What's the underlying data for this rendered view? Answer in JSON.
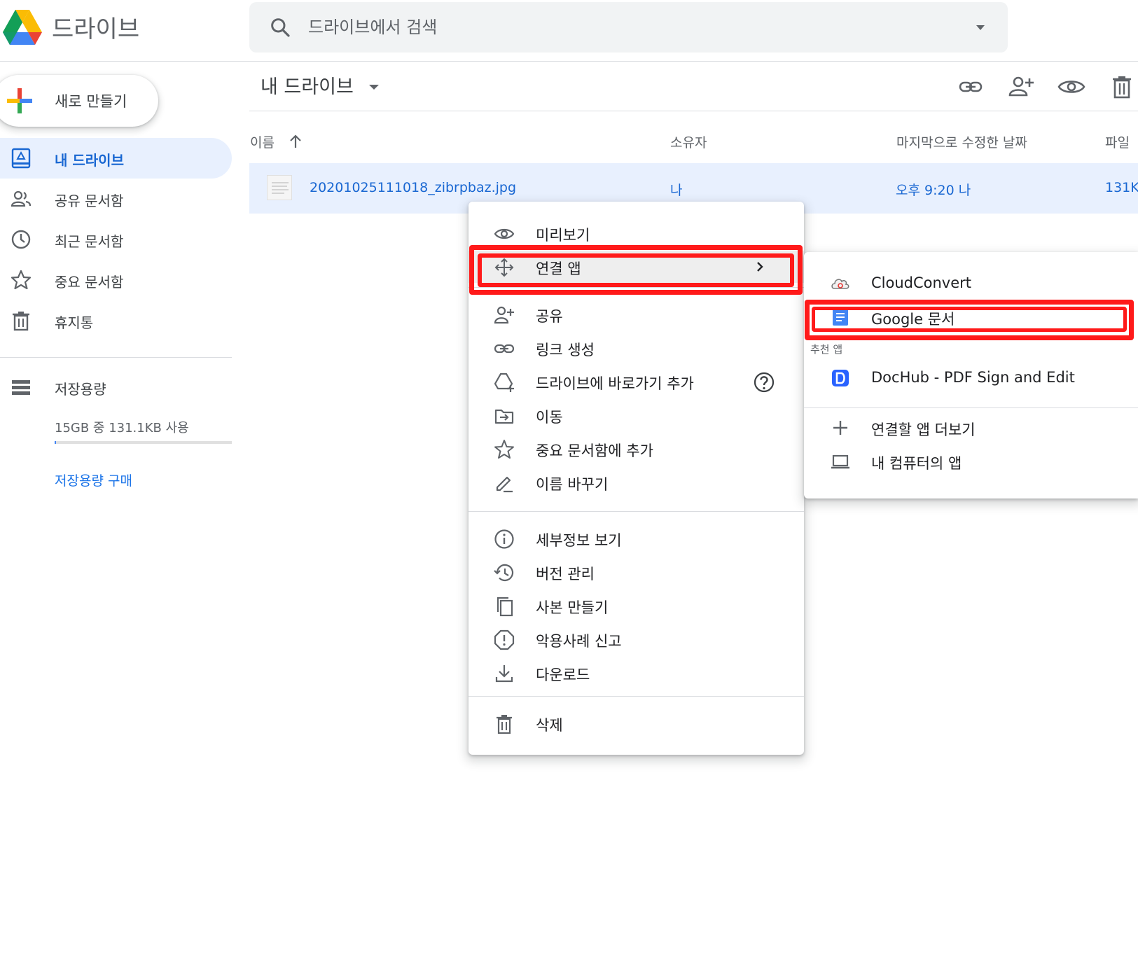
{
  "header": {
    "app_title": "드라이브",
    "search_placeholder": "드라이브에서 검색"
  },
  "sidebar": {
    "new_label": "새로 만들기",
    "items": [
      {
        "label": "내 드라이브",
        "icon": "my-drive-icon",
        "active": true
      },
      {
        "label": "공유 문서함",
        "icon": "shared-people-icon",
        "active": false
      },
      {
        "label": "최근 문서함",
        "icon": "clock-icon",
        "active": false
      },
      {
        "label": "중요 문서함",
        "icon": "star-icon",
        "active": false
      },
      {
        "label": "휴지통",
        "icon": "trash-icon",
        "active": false
      }
    ],
    "storage": {
      "label": "저장용량",
      "used_text": "15GB 중 131.1KB 사용",
      "used_fraction": 0.0001,
      "buy_label": "저장용량 구매"
    }
  },
  "main": {
    "title": "내 드라이브",
    "toolbar_icons": [
      "link-icon",
      "add-person-icon",
      "eye-icon",
      "trash-icon"
    ],
    "columns": {
      "name": "이름",
      "owner": "소유자",
      "modified": "마지막으로 수정한 날짜",
      "size": "파일"
    },
    "file": {
      "name": "20201025111018_zibrpbaz.jpg",
      "owner": "나",
      "modified": "오후 9:20 나",
      "size": "131K"
    }
  },
  "context_menu": {
    "preview": "미리보기",
    "open_with": "연결 앱",
    "share": "공유",
    "get_link": "링크 생성",
    "add_shortcut": "드라이브에 바로가기 추가",
    "move": "이동",
    "add_starred": "중요 문서함에 추가",
    "rename": "이름 바꾸기",
    "details": "세부정보 보기",
    "versions": "버전 관리",
    "make_copy": "사본 만들기",
    "report": "악용사례 신고",
    "download": "다운로드",
    "remove": "삭제"
  },
  "submenu": {
    "cloudconvert": "CloudConvert",
    "google_docs": "Google 문서",
    "suggested_header": "추천 앱",
    "dochub": "DocHub - PDF Sign and Edit",
    "connect_more": "연결할 앱 더보기",
    "computer_apps": "내 컴퓨터의 앱"
  },
  "colors": {
    "accent_blue": "#1a73e8",
    "active_bg": "#e8f0fe",
    "highlight_red": "#ff1a1a"
  }
}
